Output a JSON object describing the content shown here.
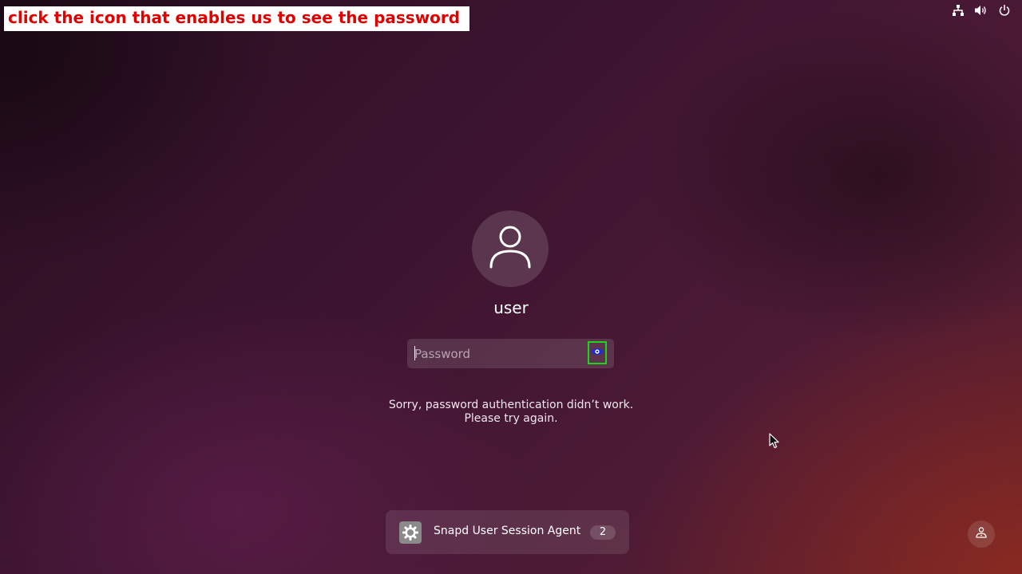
{
  "instruction": {
    "text": "click the icon that enables us to see the password"
  },
  "topbar": {
    "icons": [
      "network-icon",
      "volume-icon",
      "power-icon"
    ]
  },
  "login": {
    "avatar_icon": "user-avatar-icon",
    "username": "user",
    "password": {
      "placeholder": "Password",
      "value": "",
      "reveal_icon": "show-password-icon"
    },
    "error_line1": "Sorry, password authentication didn’t work.",
    "error_line2": "Please try again."
  },
  "notification": {
    "icon": "gear-icon",
    "title": "Snapd User Session Agent",
    "count": "2"
  },
  "accessibility": {
    "icon": "accessibility-icon"
  },
  "colors": {
    "instruction_text": "#e00000",
    "reveal_highlight": "#1fd41f",
    "reveal_icon": "#1a2bd8"
  }
}
